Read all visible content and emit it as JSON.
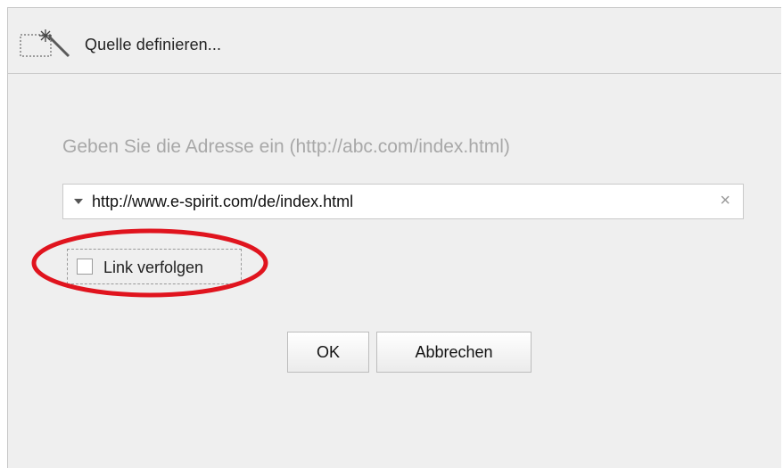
{
  "dialog": {
    "title": "Quelle definieren...",
    "title_icon": "magic-wand-selection-icon"
  },
  "prompt": "Geben Sie die Adresse ein (http://abc.com/index.html)",
  "url_field": {
    "value": "http://www.e-spirit.com/de/index.html",
    "dropdown_icon": "dropdown-arrow-icon",
    "clear_label": "×"
  },
  "checkbox": {
    "label": "Link verfolgen",
    "checked": false
  },
  "buttons": {
    "ok_label": "OK",
    "cancel_label": "Abbrechen"
  },
  "annotation": {
    "highlight_color": "#e0141e"
  }
}
